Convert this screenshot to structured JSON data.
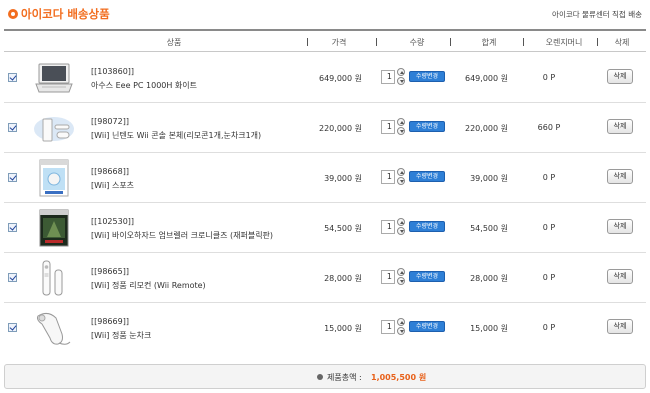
{
  "header": {
    "title": "아이코다 배송상품",
    "subtitle": "아이코다 물류센터 직접 배송"
  },
  "columns": {
    "product": "상품",
    "price": "가격",
    "qty": "수량",
    "total": "합계",
    "points": "오렌지머니",
    "delete": "삭제"
  },
  "qty_button_label": "수량변경",
  "items": [
    {
      "code": "[[103860]]",
      "name": "아수스 Eee PC 1000H 화이트",
      "price": "649,000 원",
      "qty": "1",
      "total": "649,000 원",
      "points": "0 P",
      "delete": "삭제",
      "icon": "netbook-icon"
    },
    {
      "code": "[[98072]]",
      "name": "[Wii] 닌텐도 Wii 콘솔 본체(리모콘1개,눈차크1개)",
      "price": "220,000 원",
      "qty": "1",
      "total": "220,000 원",
      "points": "660 P",
      "delete": "삭제",
      "icon": "wii-console-icon"
    },
    {
      "code": "[[98668]]",
      "name": "[Wii] 스포츠",
      "price": "39,000 원",
      "qty": "1",
      "total": "39,000 원",
      "points": "0 P",
      "delete": "삭제",
      "icon": "game-box-icon"
    },
    {
      "code": "[[102530]]",
      "name": "[Wii] 바이오하자드 엄브렐러 크로니클즈 (재퍼블릭판)",
      "price": "54,500 원",
      "qty": "1",
      "total": "54,500 원",
      "points": "0 P",
      "delete": "삭제",
      "icon": "game-box-dark-icon"
    },
    {
      "code": "[[98665]]",
      "name": "[Wii] 정품 리모컨 (Wii Remote)",
      "price": "28,000 원",
      "qty": "1",
      "total": "28,000 원",
      "points": "0 P",
      "delete": "삭제",
      "icon": "wii-remote-icon"
    },
    {
      "code": "[[98669]]",
      "name": "[Wii] 정품 눈차크",
      "price": "15,000 원",
      "qty": "1",
      "total": "15,000 원",
      "points": "0 P",
      "delete": "삭제",
      "icon": "nunchuk-icon"
    }
  ],
  "summary": {
    "label": "제품총액 :",
    "amount": "1,005,500 원"
  },
  "colors": {
    "accent": "#f26d1f",
    "button_blue": "#2e7fd6",
    "amount": "#e8611a"
  }
}
